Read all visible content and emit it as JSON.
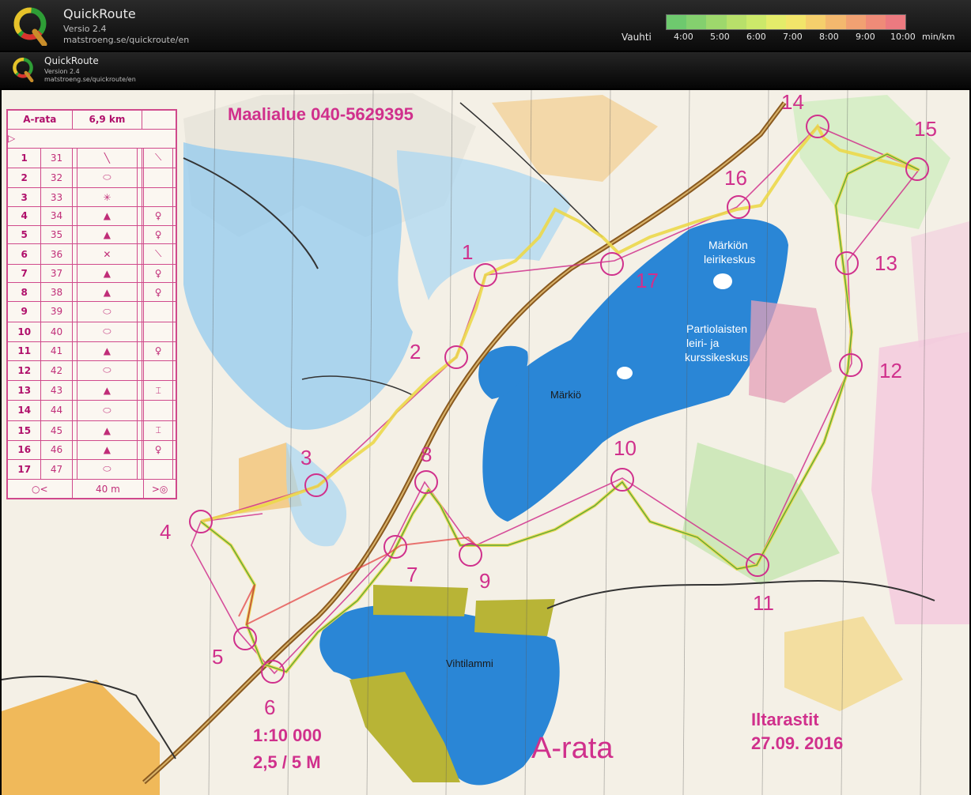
{
  "app": {
    "title": "QuickRoute",
    "version": "Versio 2.4",
    "url": "matstroeng.se/quickroute/en"
  },
  "embedded_header": {
    "title": "QuickRoute",
    "version": "Version 2.4",
    "url": "matstroeng.se/quickroute/en"
  },
  "legend": {
    "label": "Vauhti",
    "unit": "min/km",
    "ticks": [
      "4:00",
      "5:00",
      "6:00",
      "7:00",
      "8:00",
      "9:00",
      "10:00"
    ]
  },
  "colors": {
    "scale": [
      "#6ec96e",
      "#84d06e",
      "#9ed86c",
      "#b8e06a",
      "#cce96a",
      "#e4ec6a",
      "#f2e56a",
      "#f5cf6c",
      "#f3b86e",
      "#f1a172",
      "#ef8b78",
      "#ec7a80"
    ],
    "route_fast": "#3a9c2e",
    "route_slow": "#e23a3a",
    "course": "#d0308c",
    "water": "#2a86d6",
    "marsh": "#7ac0ec"
  },
  "map": {
    "finish_area": "Maalialue 040-5629395",
    "lake_big": "Märkiö",
    "lake_small": "Vihtilammi",
    "camp1_line1": "Märkiön",
    "camp1_line2": "leirikeskus",
    "camp2_line1": "Partiolaisten",
    "camp2_line2": "leiri- ja",
    "camp2_line3": "kurssikeskus",
    "scale_text": "1:10 000",
    "contour_text": "2,5 / 5 M",
    "course_title": "A-rata",
    "event_name": "Iltarastit",
    "event_date": "27.09. 2016"
  },
  "control_labels": [
    "1",
    "2",
    "3",
    "4",
    "5",
    "6",
    "7",
    "8",
    "9",
    "10",
    "11",
    "12",
    "13",
    "14",
    "15",
    "16",
    "17"
  ],
  "clue_sheet": {
    "course": "A-rata",
    "length": "6,9 km",
    "rows": [
      {
        "n": "1",
        "code": "31",
        "sym": "╲",
        "extra": "⟍"
      },
      {
        "n": "2",
        "code": "32",
        "sym": "⬭",
        "extra": ""
      },
      {
        "n": "3",
        "code": "33",
        "sym": "✳",
        "extra": ""
      },
      {
        "n": "4",
        "code": "34",
        "sym": "▲",
        "extra": "♀"
      },
      {
        "n": "5",
        "code": "35",
        "sym": "▲",
        "extra": "♀"
      },
      {
        "n": "6",
        "code": "36",
        "sym": "✕",
        "extra": "⟍"
      },
      {
        "n": "7",
        "code": "37",
        "sym": "▲",
        "extra": "♀"
      },
      {
        "n": "8",
        "code": "38",
        "sym": "▲",
        "extra": "♀"
      },
      {
        "n": "9",
        "code": "39",
        "sym": "⬭",
        "extra": ""
      },
      {
        "n": "10",
        "code": "40",
        "sym": "⬭",
        "extra": ""
      },
      {
        "n": "11",
        "code": "41",
        "sym": "▲",
        "extra": "♀"
      },
      {
        "n": "12",
        "code": "42",
        "sym": "⬭",
        "extra": ""
      },
      {
        "n": "13",
        "code": "43",
        "sym": "▲",
        "extra": "⌶"
      },
      {
        "n": "14",
        "code": "44",
        "sym": "⬭",
        "extra": ""
      },
      {
        "n": "15",
        "code": "45",
        "sym": "▲",
        "extra": "⌶"
      },
      {
        "n": "16",
        "code": "46",
        "sym": "▲",
        "extra": "♀"
      },
      {
        "n": "17",
        "code": "47",
        "sym": "⬭",
        "extra": ""
      }
    ],
    "footer_distance": "40 m"
  }
}
